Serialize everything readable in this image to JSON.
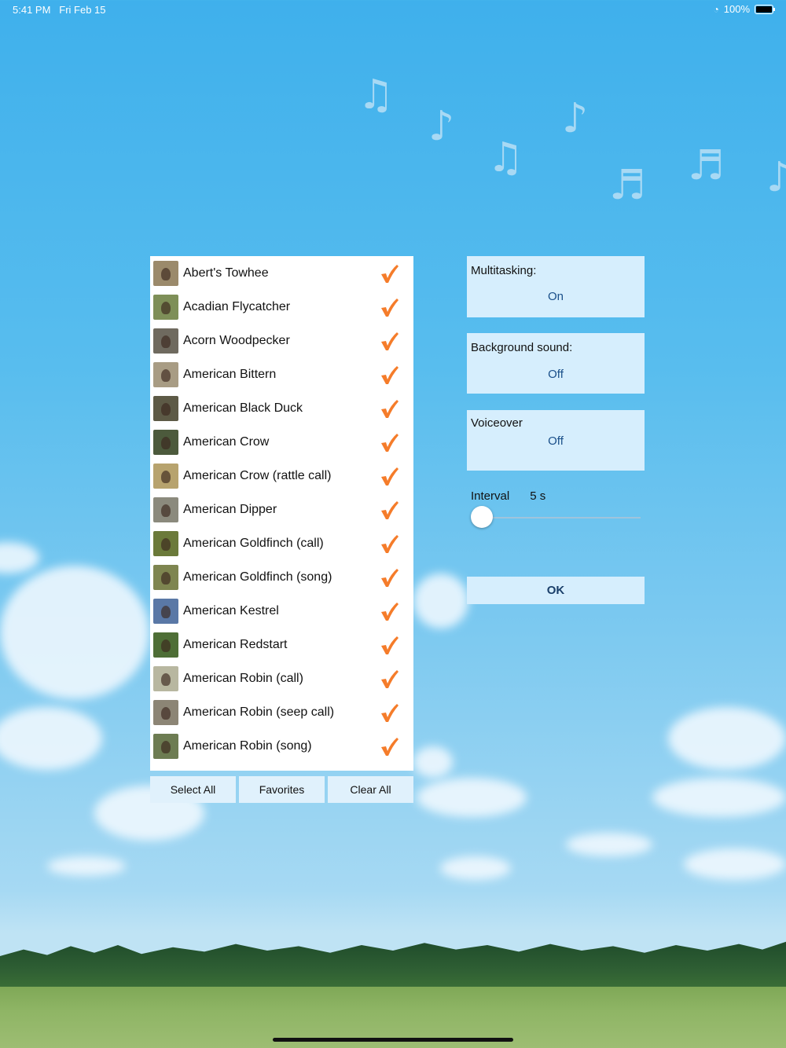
{
  "status": {
    "time": "5:41 PM",
    "date": "Fri Feb 15",
    "battery": "100%"
  },
  "birds": [
    {
      "name": "Abert's Towhee",
      "thumb": "#9b8a6b"
    },
    {
      "name": "Acadian Flycatcher",
      "thumb": "#7e8f58"
    },
    {
      "name": "Acorn Woodpecker",
      "thumb": "#6f6a5f"
    },
    {
      "name": "American Bittern",
      "thumb": "#a89c84"
    },
    {
      "name": "American Black Duck",
      "thumb": "#5d5a46"
    },
    {
      "name": "American Crow",
      "thumb": "#4c5a3c"
    },
    {
      "name": "American Crow (rattle call)",
      "thumb": "#b7a36e"
    },
    {
      "name": "American Dipper",
      "thumb": "#8b8a7d"
    },
    {
      "name": "American Goldfinch (call)",
      "thumb": "#6b7a3a"
    },
    {
      "name": "American Goldfinch (song)",
      "thumb": "#7e8550"
    },
    {
      "name": "American Kestrel",
      "thumb": "#5a78a6"
    },
    {
      "name": "American Redstart",
      "thumb": "#4e6e36"
    },
    {
      "name": "American Robin (call)",
      "thumb": "#b8b7a0"
    },
    {
      "name": "American Robin (seep call)",
      "thumb": "#8c8575"
    },
    {
      "name": "American Robin (song)",
      "thumb": "#6d7c52"
    }
  ],
  "buttons": {
    "select_all": "Select All",
    "favorites": "Favorites",
    "clear_all": "Clear All",
    "ok": "OK"
  },
  "settings": {
    "multitasking": {
      "label": "Multitasking:",
      "value": "On"
    },
    "background_sound": {
      "label": "Background sound:",
      "value": "Off"
    },
    "voiceover": {
      "label": "Voiceover",
      "value": "Off"
    },
    "interval": {
      "label": "Interval",
      "value": "5 s",
      "slider_fraction": 0
    }
  },
  "colors": {
    "check": "#f57c2a",
    "panel": "#d6eefd",
    "value_text": "#1a4f8a"
  }
}
